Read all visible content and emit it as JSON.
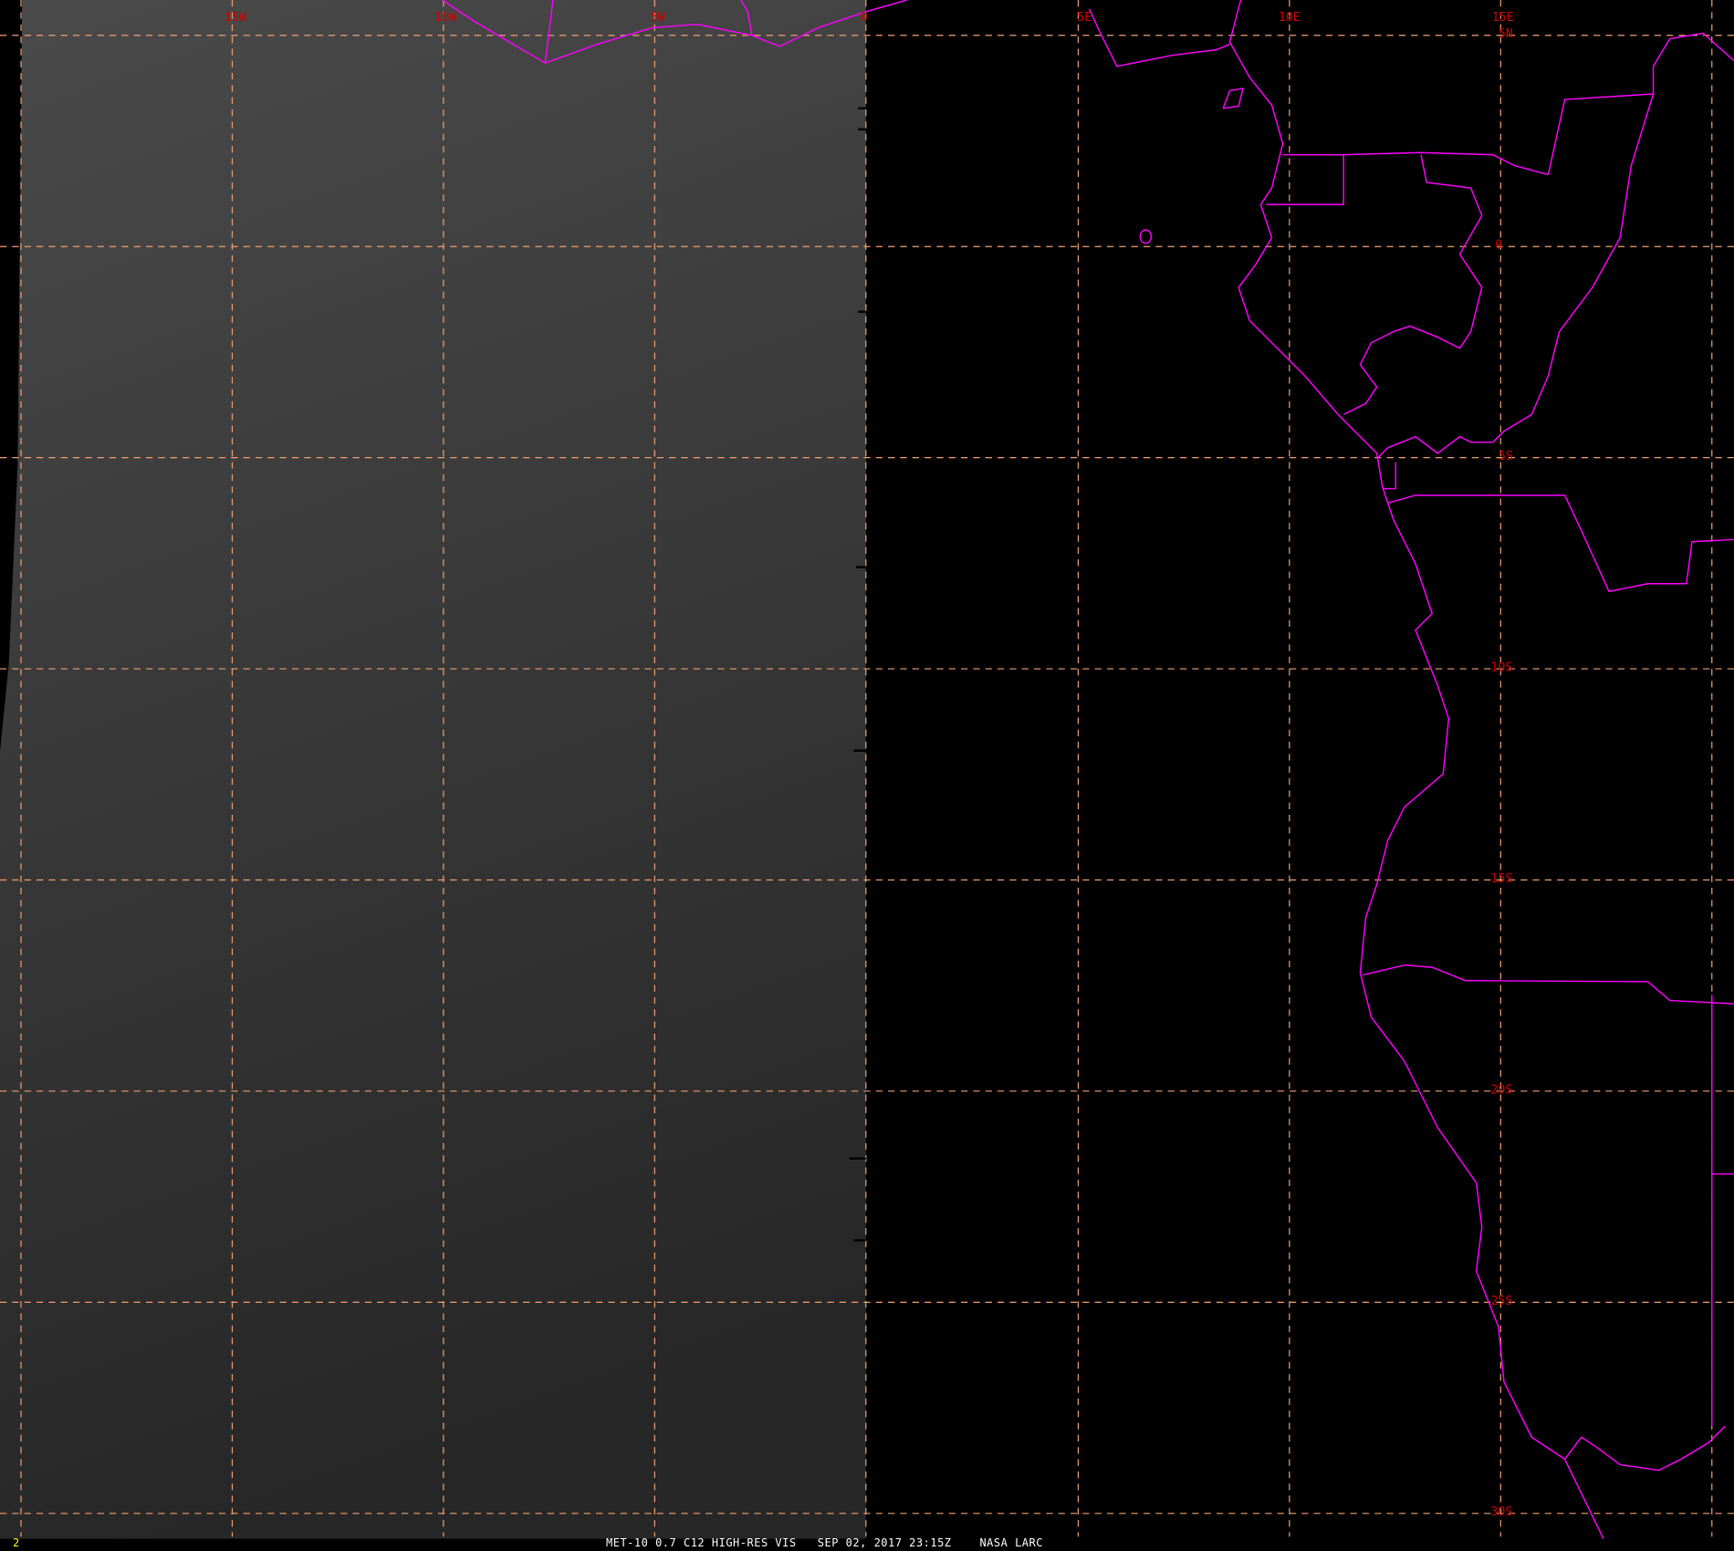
{
  "frame_number": "2",
  "caption": {
    "product": "MET-10 0.7 C12 HIGH-RES VIS",
    "datetime": "SEP 02, 2017 23:15Z",
    "source": "NASA LARC"
  },
  "longitude_labels": [
    "15W",
    "10W",
    "5W",
    "0",
    "5E",
    "10E",
    "15E"
  ],
  "latitude_labels": [
    "5N",
    "0",
    "5S",
    "10S",
    "15S",
    "20S",
    "25S",
    "30S"
  ],
  "colors": {
    "grid": "#f0a070",
    "coast": "#ff00ff",
    "label": "#d00000",
    "frame": "#ffff00"
  }
}
